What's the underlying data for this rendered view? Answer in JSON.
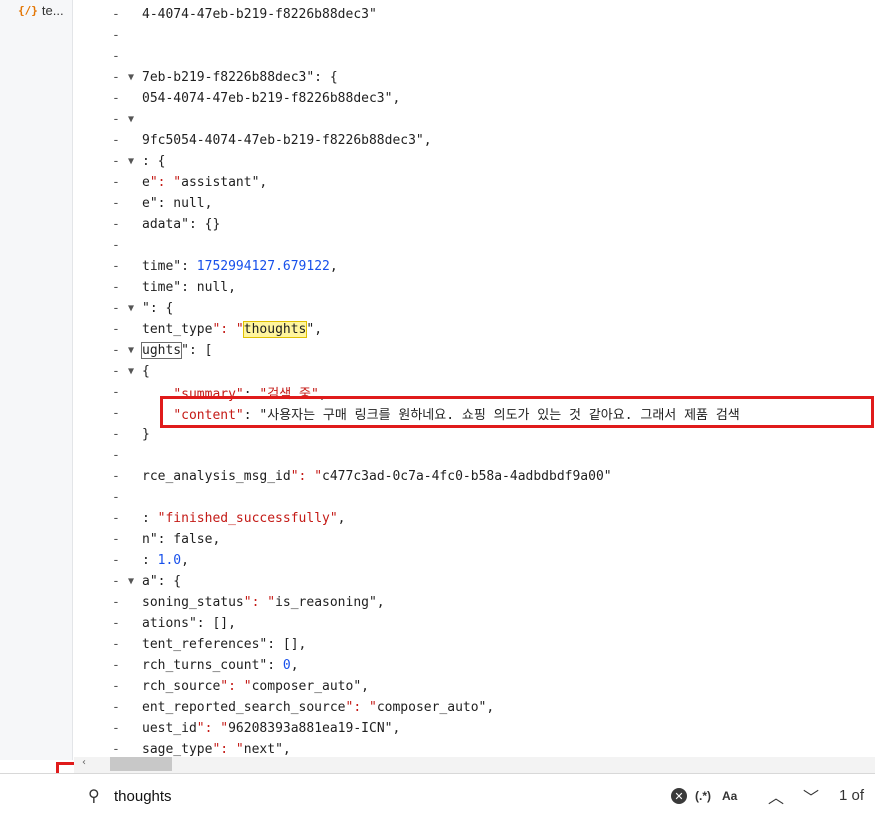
{
  "tab": {
    "icon": "{/}",
    "label": "te..."
  },
  "lines": [
    {
      "m": "-",
      "a": "",
      "t": "4-4074-47eb-b219-f8226b88dec3\""
    },
    {
      "m": "-",
      "a": "",
      "t": ""
    },
    {
      "m": "-",
      "a": "",
      "t": ""
    },
    {
      "m": "-",
      "a": "▼",
      "t": "7eb-b219-f8226b88dec3\": {"
    },
    {
      "m": "-",
      "a": "",
      "t": "054-4074-47eb-b219-f8226b88dec3\","
    },
    {
      "m": "-",
      "a": "▼",
      "t": ""
    },
    {
      "m": "-",
      "a": "",
      "t": "9fc5054-4074-47eb-b219-f8226b88dec3\","
    },
    {
      "m": "-",
      "a": "▼",
      "t": ": {"
    },
    {
      "m": "-",
      "a": "",
      "t": "e\": \"assistant\","
    },
    {
      "m": "-",
      "a": "",
      "t": "e\": null,"
    },
    {
      "m": "-",
      "a": "",
      "t": "adata\": {}"
    },
    {
      "m": "-",
      "a": "",
      "t": ""
    },
    {
      "m": "-",
      "a": "",
      "t": "time\": 1752994127.679122,"
    },
    {
      "m": "-",
      "a": "",
      "t": "time\": null,"
    },
    {
      "m": "-",
      "a": "▼",
      "t": "\": {"
    },
    {
      "m": "-",
      "a": "",
      "t": "tent_type\": \"thoughts\","
    },
    {
      "m": "-",
      "a": "▼",
      "t": "ughts\": ["
    },
    {
      "m": "-",
      "a": "▼",
      "t": "{"
    },
    {
      "m": "-",
      "a": "",
      "t": "    \"summary\": \"검색 중\","
    },
    {
      "m": "-",
      "a": "",
      "t": "    \"content\": \"사용자는 구매 링크를 원하네요. 쇼핑 의도가 있는 것 같아요. 그래서 제품 검색"
    },
    {
      "m": "-",
      "a": "",
      "t": "}"
    },
    {
      "m": "-",
      "a": "",
      "t": ""
    },
    {
      "m": "-",
      "a": "",
      "t": "rce_analysis_msg_id\": \"c477c3ad-0c7a-4fc0-b58a-4adbdbdf9a00\""
    },
    {
      "m": "-",
      "a": "",
      "t": ""
    },
    {
      "m": "-",
      "a": "",
      "t": ": \"finished_successfully\","
    },
    {
      "m": "-",
      "a": "",
      "t": "n\": false,"
    },
    {
      "m": "-",
      "a": "",
      "t": ": 1.0,"
    },
    {
      "m": "-",
      "a": "▼",
      "t": "a\": {"
    },
    {
      "m": "-",
      "a": "",
      "t": "soning_status\": \"is_reasoning\","
    },
    {
      "m": "-",
      "a": "",
      "t": "ations\": [],"
    },
    {
      "m": "-",
      "a": "",
      "t": "tent_references\": [],"
    },
    {
      "m": "-",
      "a": "",
      "t": "rch_turns_count\": 0,"
    },
    {
      "m": "-",
      "a": "",
      "t": "rch_source\": \"composer_auto\","
    },
    {
      "m": "-",
      "a": "",
      "t": "ent_reported_search_source\": \"composer_auto\","
    },
    {
      "m": "-",
      "a": "",
      "t": "uest_id\": \"96208393a881ea19-ICN\","
    },
    {
      "m": "-",
      "a": "",
      "t": "sage_type\": \"next\","
    }
  ],
  "scroll_left": "‹",
  "find": {
    "search_icon": "search-icon",
    "query": "thoughts",
    "clear": "✕",
    "regex": "(.*)",
    "case": "Aa",
    "prev": "︿",
    "next": "﹀",
    "count": "1 of"
  },
  "colors": {
    "highlight": "#fff59d",
    "redbox": "#e01b1b"
  }
}
